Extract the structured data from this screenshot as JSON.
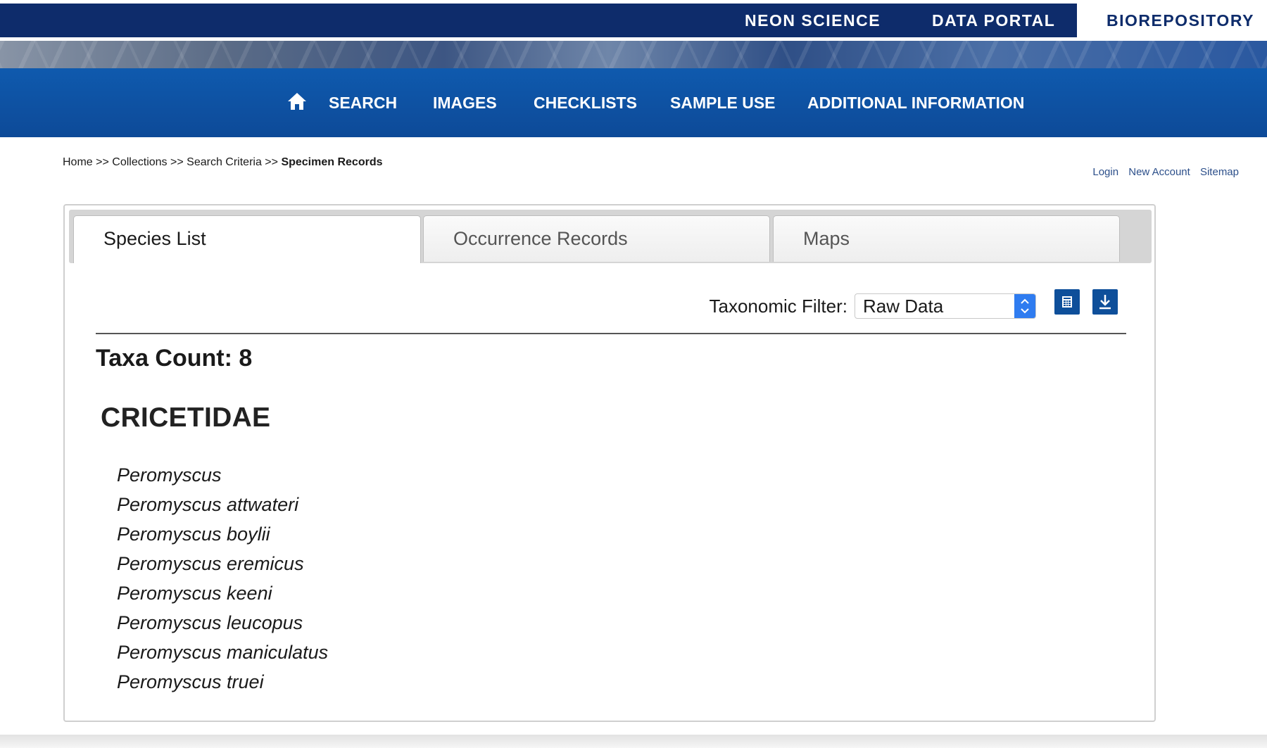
{
  "topbar": {
    "links": [
      "NEON SCIENCE",
      "DATA PORTAL",
      "BIOREPOSITORY"
    ],
    "active": "BIOREPOSITORY"
  },
  "mainnav": {
    "items": [
      "SEARCH",
      "IMAGES",
      "CHECKLISTS",
      "SAMPLE USE",
      "ADDITIONAL INFORMATION"
    ]
  },
  "breadcrumb": {
    "home": "Home",
    "collections": "Collections",
    "search_criteria": "Search Criteria",
    "current": "Specimen Records",
    "separator": ">>"
  },
  "utility_links": [
    "Login",
    "New Account",
    "Sitemap"
  ],
  "tabs": [
    "Species List",
    "Occurrence Records",
    "Maps"
  ],
  "active_tab": "Species List",
  "filter": {
    "label": "Taxonomic Filter:",
    "selected": "Raw Data"
  },
  "icons": {
    "home": "home-icon",
    "table": "table-icon",
    "download": "download-icon"
  },
  "content": {
    "taxa_count_label": "Taxa Count: 8",
    "family": "CRICETIDAE",
    "species": [
      "Peromyscus",
      "Peromyscus attwateri",
      "Peromyscus boylii",
      "Peromyscus eremicus",
      "Peromyscus keeni",
      "Peromyscus leucopus",
      "Peromyscus maniculatus",
      "Peromyscus truei"
    ]
  },
  "colors": {
    "topbar": "#0e2c6b",
    "nav": "#0f5aae",
    "link": "#2c4f8a",
    "select_accent": "#2f7cf0"
  }
}
